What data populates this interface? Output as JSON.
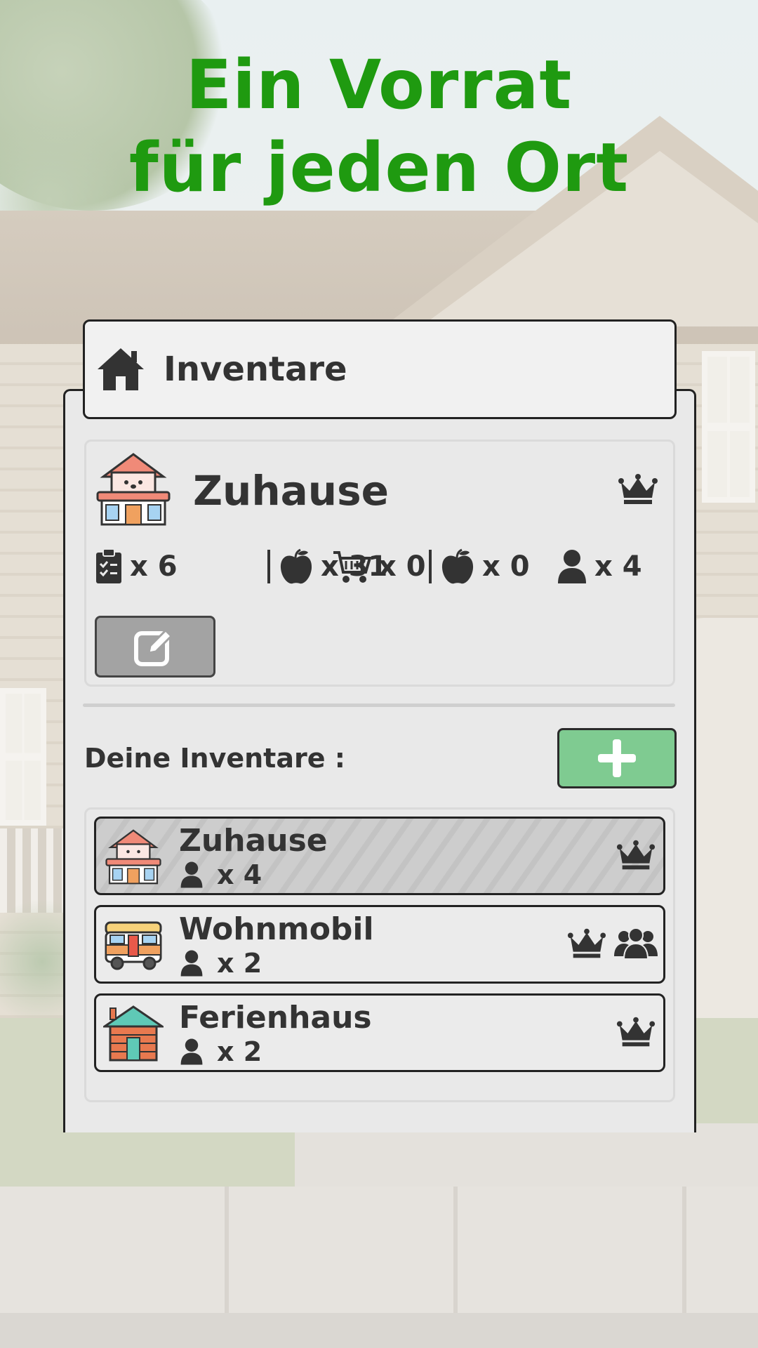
{
  "headline": {
    "line1": "Ein Vorrat",
    "line2": "für jeden Ort"
  },
  "header": {
    "title": "Inventare",
    "icon": "home-icon"
  },
  "current_inventory": {
    "name": "Zuhause",
    "icon": "house-icon",
    "owner_icon": "crown-icon",
    "stats": {
      "lists": "x 6",
      "items": "x 31",
      "cart": "x 0",
      "cart_items": "x 0",
      "members": "x 4"
    },
    "edit_icon": "edit-icon"
  },
  "inventories_section": {
    "label": "Deine Inventare :",
    "add_icon": "plus-icon"
  },
  "inventories": [
    {
      "name": "Zuhause",
      "members": "x 4",
      "icon": "house-icon",
      "owner": true,
      "shared": false,
      "active": true
    },
    {
      "name": "Wohnmobil",
      "members": "x 2",
      "icon": "camper-icon",
      "owner": true,
      "shared": true,
      "active": false
    },
    {
      "name": "Ferienhaus",
      "members": "x 2",
      "icon": "cabin-icon",
      "owner": true,
      "shared": false,
      "active": false
    }
  ],
  "colors": {
    "headline": "#1f9a10",
    "add_button": "#7fcb91",
    "edit_button": "#a3a3a3"
  }
}
